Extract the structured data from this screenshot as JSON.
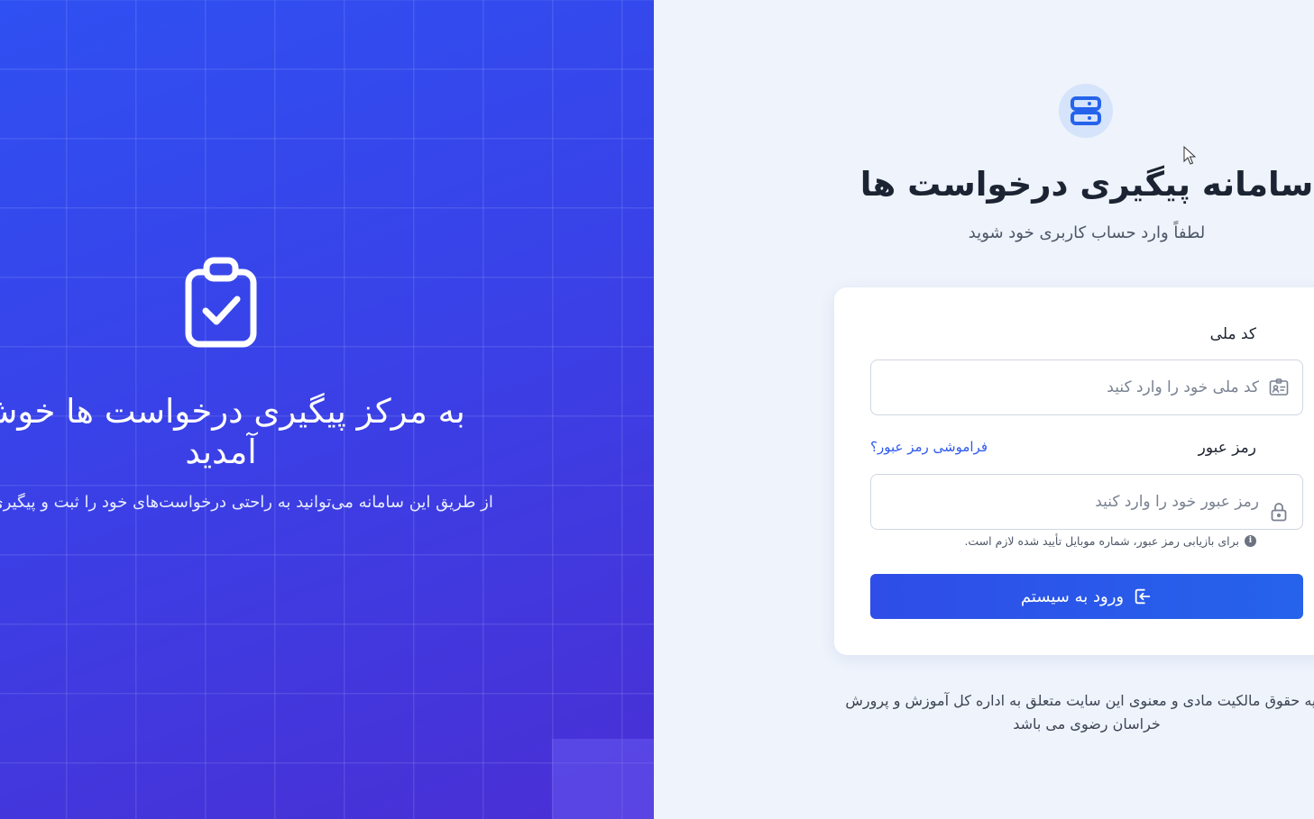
{
  "hero": {
    "icon": "clipboard-check-icon",
    "title": "به مرکز پیگیری درخواست ها خوش آمدید",
    "description": "از طریق این سامانه می‌توانید به راحتی درخواست‌های خود را ثبت و پیگیری نمایید"
  },
  "brand": {
    "icon": "server-icon",
    "title": "سامانه پیگیری درخواست ها",
    "subtitle": "لطفاً وارد حساب کاربری خود شوید"
  },
  "form": {
    "national_id": {
      "label": "کد ملی",
      "placeholder": "کد ملی خود را وارد کنید",
      "value": "",
      "icon": "id-card-icon"
    },
    "password": {
      "label": "رمز عبور",
      "placeholder": "رمز عبور خود را وارد کنید",
      "value": "",
      "icon": "lock-icon",
      "forgot_link": "فراموشی رمز عبور؟"
    },
    "hint": {
      "icon": "info-icon",
      "text": "برای بازیابی رمز عبور، شماره موبایل تأیید شده لازم است."
    },
    "submit": {
      "label": "ورود به سیستم",
      "icon": "login-icon"
    }
  },
  "footer": {
    "text": "کلیه حقوق مالکیت مادی و معنوی این سایت متعلق به اداره کل آموزش و پرورش خراسان رضوی می باشد"
  },
  "colors": {
    "primary": "#2f55ee",
    "hero_start": "#2f50f2",
    "hero_end": "#4a2fd4",
    "background": "#eef3fc"
  }
}
